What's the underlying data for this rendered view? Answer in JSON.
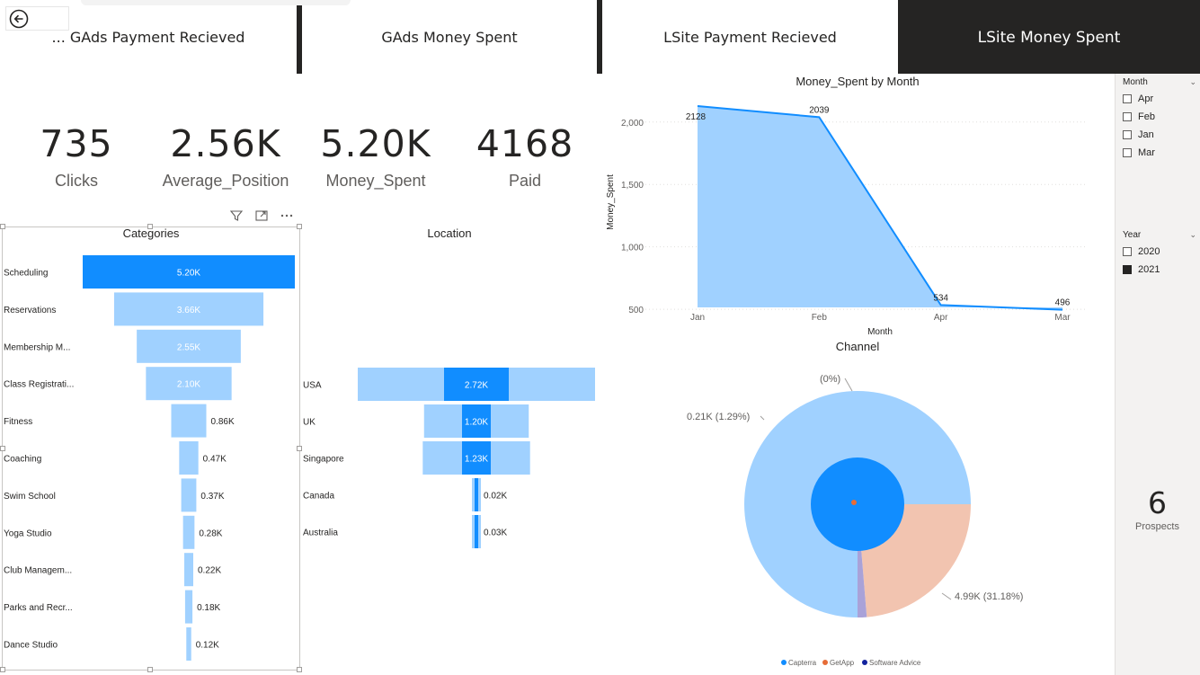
{
  "tabs": [
    {
      "label": "... GAds Payment Recieved",
      "active": false
    },
    {
      "label": "GAds Money Spent",
      "active": false
    },
    {
      "label": "LSite Payment Recieved",
      "active": false
    },
    {
      "label": "LSite Money Spent",
      "active": true
    }
  ],
  "kpis": [
    {
      "value": "735",
      "label": "Clicks"
    },
    {
      "value": "2.56K",
      "label": "Average_Position"
    },
    {
      "value": "5.20K",
      "label": "Money_Spent"
    },
    {
      "value": "4168",
      "label": "Paid"
    }
  ],
  "categories_title": "Categories",
  "location_title": "Location",
  "line_title": "Money_Spent by Month",
  "pie_title": "Channel",
  "slicers": {
    "month": {
      "title": "Month",
      "options": [
        {
          "label": "Apr",
          "checked": false
        },
        {
          "label": "Feb",
          "checked": false
        },
        {
          "label": "Jan",
          "checked": false
        },
        {
          "label": "Mar",
          "checked": false
        }
      ]
    },
    "year": {
      "title": "Year",
      "options": [
        {
          "label": "2020",
          "checked": false
        },
        {
          "label": "2021",
          "checked": true
        }
      ]
    }
  },
  "prospects": {
    "value": "6",
    "label": "Prospects"
  },
  "colors": {
    "dark": "#252423",
    "highlight": "#118dff",
    "light": "#a0d1ff",
    "salmon": "#f2c4b0",
    "purple": "#a9a2d8"
  },
  "chart_data": [
    {
      "type": "bar",
      "subtype": "funnel",
      "title": "Categories",
      "categories": [
        "Scheduling",
        "Reservations",
        "Membership M...",
        "Class Registrati...",
        "Fitness",
        "Coaching",
        "Swim School",
        "Yoga Studio",
        "Club Managem...",
        "Parks and Recr...",
        "Dance Studio"
      ],
      "values": [
        5200,
        3660,
        2550,
        2100,
        860,
        470,
        370,
        280,
        220,
        180,
        120
      ],
      "labels": [
        "5.20K",
        "3.66K",
        "2.55K",
        "2.10K",
        "0.86K",
        "0.47K",
        "0.37K",
        "0.28K",
        "0.22K",
        "0.18K",
        "0.12K"
      ]
    },
    {
      "type": "bar",
      "subtype": "funnel",
      "title": "Location",
      "categories": [
        "USA",
        "UK",
        "Singapore",
        "Canada",
        "Australia"
      ],
      "values": [
        2720,
        1200,
        1230,
        20,
        30
      ],
      "labels": [
        "2.72K",
        "1.20K",
        "1.23K",
        "0.02K",
        "0.03K"
      ]
    },
    {
      "type": "area",
      "title": "Money_Spent by Month",
      "x": [
        "Jan",
        "Feb",
        "Apr",
        "Mar"
      ],
      "y": [
        2128,
        2039,
        534,
        496
      ],
      "xlabel": "Month",
      "ylabel": "Money_Spent",
      "yticks": [
        "500",
        "1,000",
        "1,500",
        "2,000"
      ],
      "ylim": [
        500,
        2128
      ],
      "grid": true
    },
    {
      "type": "pie",
      "subtype": "donut",
      "title": "Channel",
      "slices": [
        {
          "name": "Capterra",
          "value": 4990,
          "label": "4.99K (31.18%)"
        },
        {
          "name": "GetApp",
          "value": 210,
          "label": "0.21K (1.29%)"
        },
        {
          "name": "Software Advice",
          "value": 0,
          "label": "(0%)"
        }
      ],
      "legend": "bottom"
    }
  ]
}
